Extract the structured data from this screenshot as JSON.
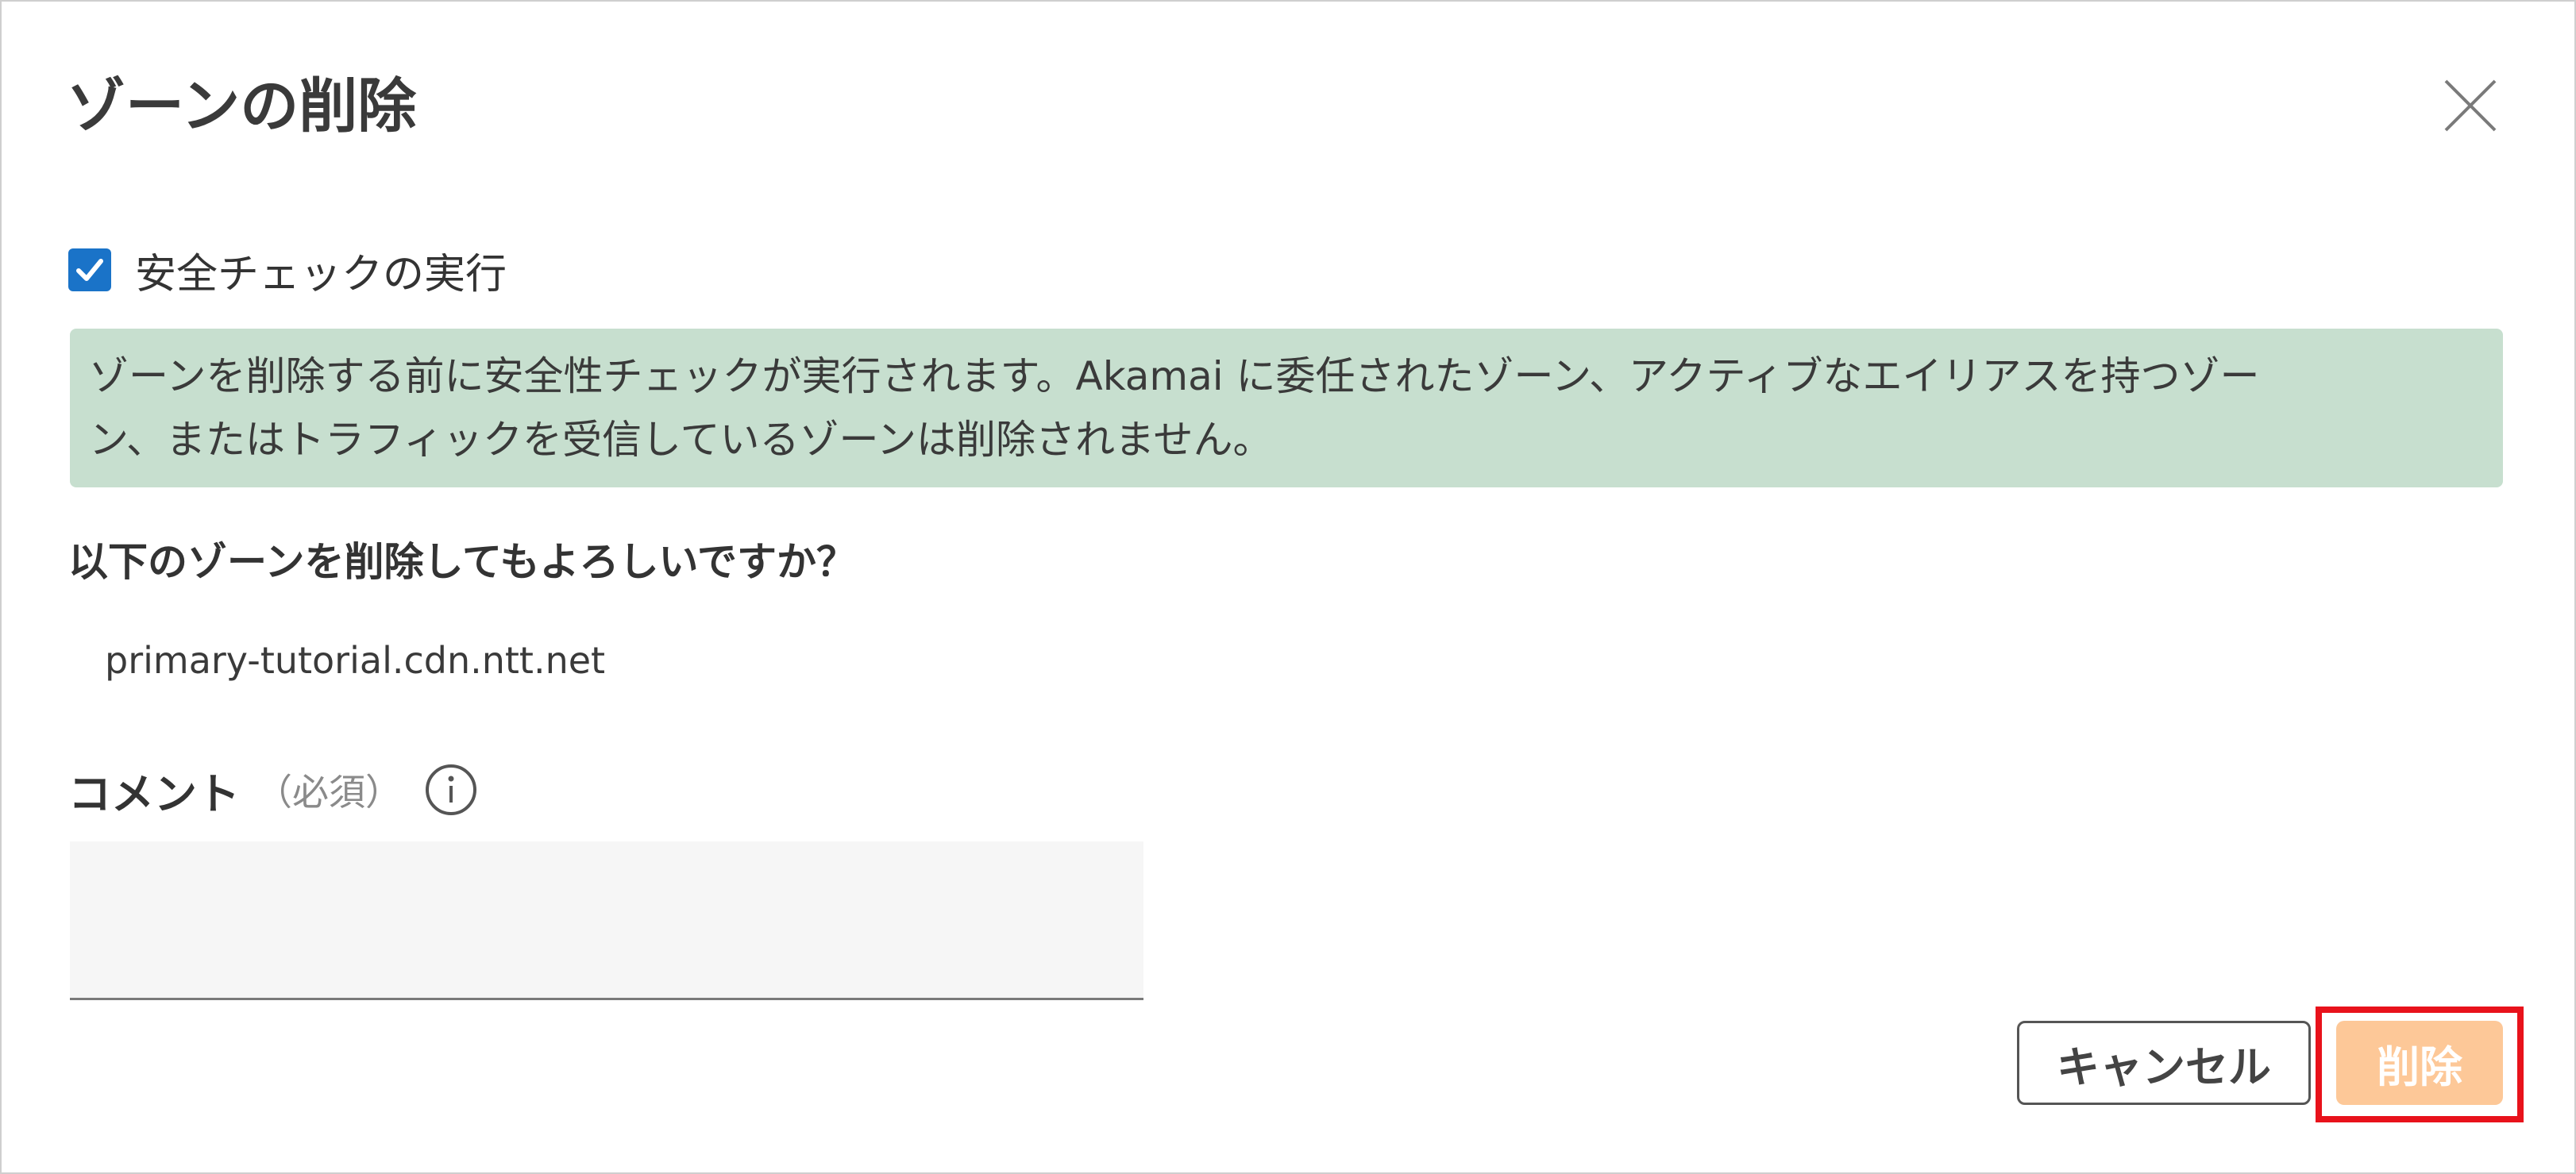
{
  "dialog": {
    "title": "ゾーンの削除",
    "close_icon": "close-icon"
  },
  "safety_check": {
    "label": "安全チェックの実行",
    "checked": true
  },
  "info": {
    "line1": "ゾーンを削除する前に安全性チェックが実行されます。Akamai に委任されたゾーン、アクティブなエイリアスを持つゾー",
    "line2": "ン、またはトラフィックを受信しているゾーンは削除されません。",
    "background_color": "#c7dfcf"
  },
  "confirmation": {
    "question": "以下のゾーンを削除してもよろしいですか？",
    "zone_name": "primary-tutorial.cdn.ntt.net"
  },
  "comment": {
    "label": "コメント",
    "required_text": "（必須）",
    "info_icon": "info-icon",
    "value": ""
  },
  "buttons": {
    "cancel_label": "キャンセル",
    "delete_label": "削除",
    "accent_color": "#fdc898",
    "highlight_color": "#e8121b"
  }
}
